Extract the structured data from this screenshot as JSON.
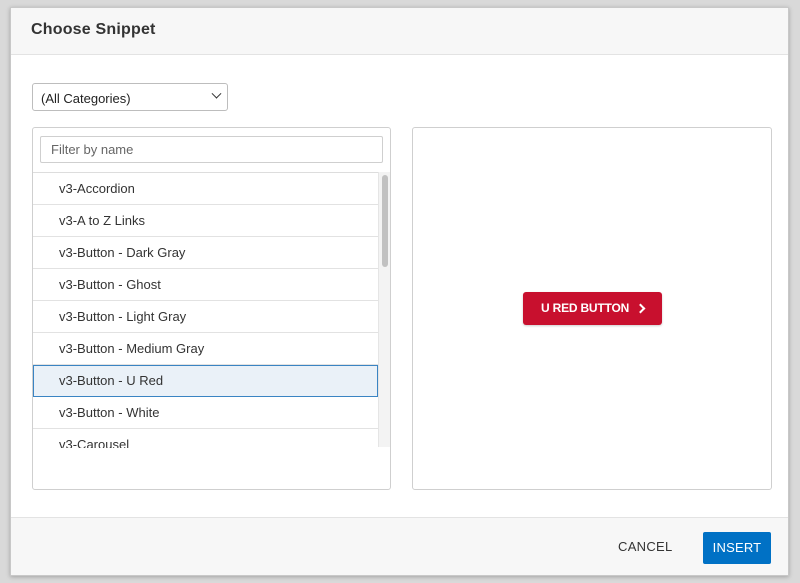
{
  "dialog": {
    "title": "Choose Snippet"
  },
  "category_select": {
    "value": "(All Categories)"
  },
  "filter": {
    "placeholder": "Filter by name",
    "value": ""
  },
  "snippets": {
    "items": [
      {
        "label": "v3-Accordion"
      },
      {
        "label": "v3-A to Z Links"
      },
      {
        "label": "v3-Button - Dark Gray"
      },
      {
        "label": "v3-Button - Ghost"
      },
      {
        "label": "v3-Button - Light Gray"
      },
      {
        "label": "v3-Button - Medium Gray"
      },
      {
        "label": "v3-Button - U Red",
        "selected": true
      },
      {
        "label": "v3-Button - White"
      },
      {
        "label": "v3-Carousel"
      }
    ]
  },
  "preview": {
    "button_label": "U RED BUTTON",
    "button_icon": "chevron-right-icon",
    "button_color": "#c8102e"
  },
  "footer": {
    "cancel_label": "CANCEL",
    "insert_label": "INSERT",
    "insert_color": "#0071c5"
  }
}
